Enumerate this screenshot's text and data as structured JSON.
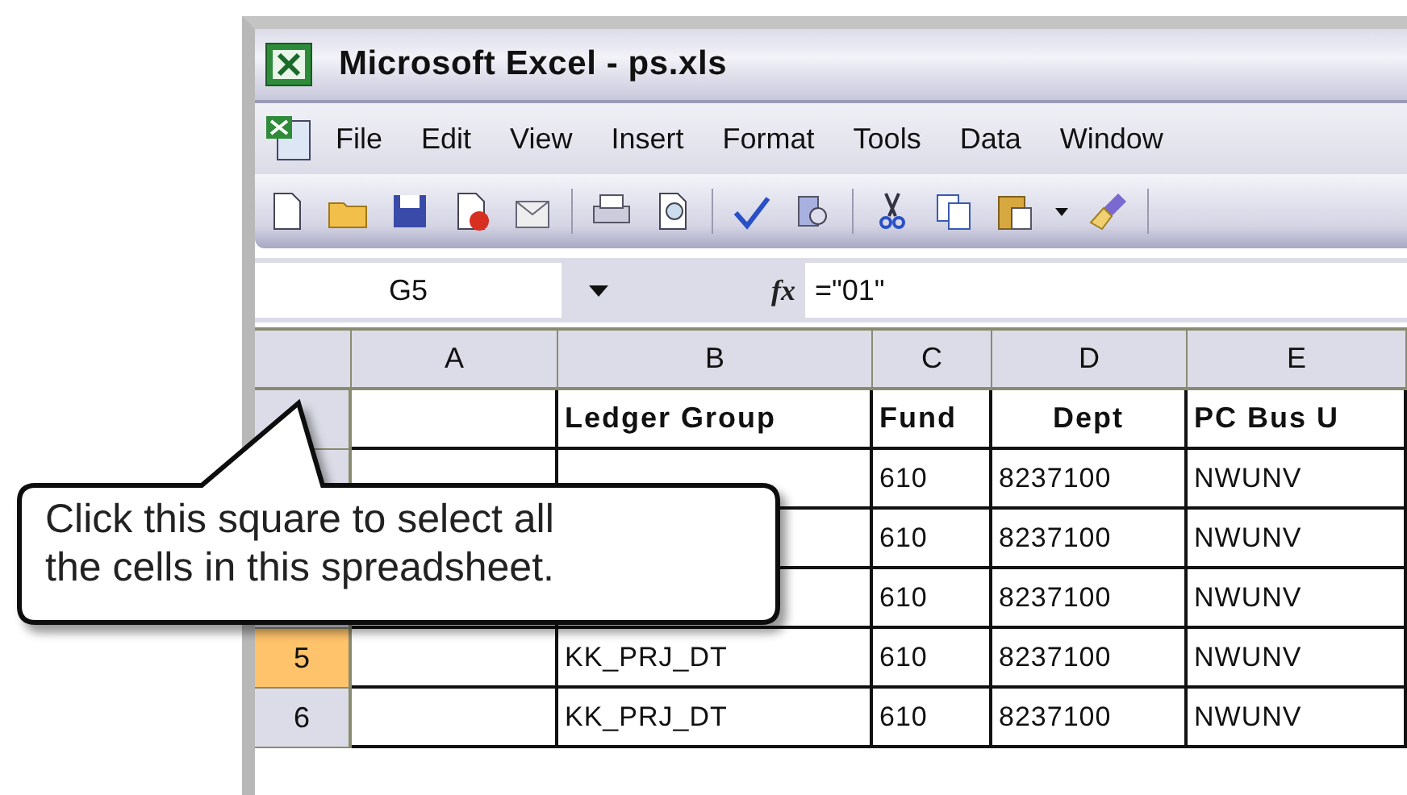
{
  "window": {
    "title": "Microsoft Excel - ps.xls"
  },
  "menu": [
    {
      "label": "File"
    },
    {
      "label": "Edit"
    },
    {
      "label": "View"
    },
    {
      "label": "Insert"
    },
    {
      "label": "Format"
    },
    {
      "label": "Tools"
    },
    {
      "label": "Data"
    },
    {
      "label": "Window"
    }
  ],
  "formula_bar": {
    "name_box": "G5",
    "fx": "fx",
    "formula": "=\"01\""
  },
  "columns": [
    "A",
    "B",
    "C",
    "D",
    "E"
  ],
  "rows": [
    {
      "kind": "header",
      "cells": [
        "",
        "Ledger Group",
        "Fund",
        "Dept",
        "PC Bus U"
      ]
    },
    {
      "kind": "data",
      "cells": [
        "",
        "",
        "610",
        "8237100",
        "NWUNV"
      ]
    },
    {
      "kind": "data",
      "cells": [
        "",
        "",
        "610",
        "8237100",
        "NWUNV"
      ]
    },
    {
      "kind": "data",
      "cells": [
        "",
        "",
        "610",
        "8237100",
        "NWUNV"
      ]
    },
    {
      "kind": "data",
      "number": "5",
      "selected": true,
      "cells": [
        "",
        "KK_PRJ_DT",
        "610",
        "8237100",
        "NWUNV"
      ]
    },
    {
      "kind": "data",
      "number": "6",
      "selected": false,
      "cells": [
        "",
        "KK_PRJ_DT",
        "610",
        "8237100",
        "NWUNV"
      ]
    }
  ],
  "callout": {
    "text": "Click this square to select all the cells in this spreadsheet."
  }
}
